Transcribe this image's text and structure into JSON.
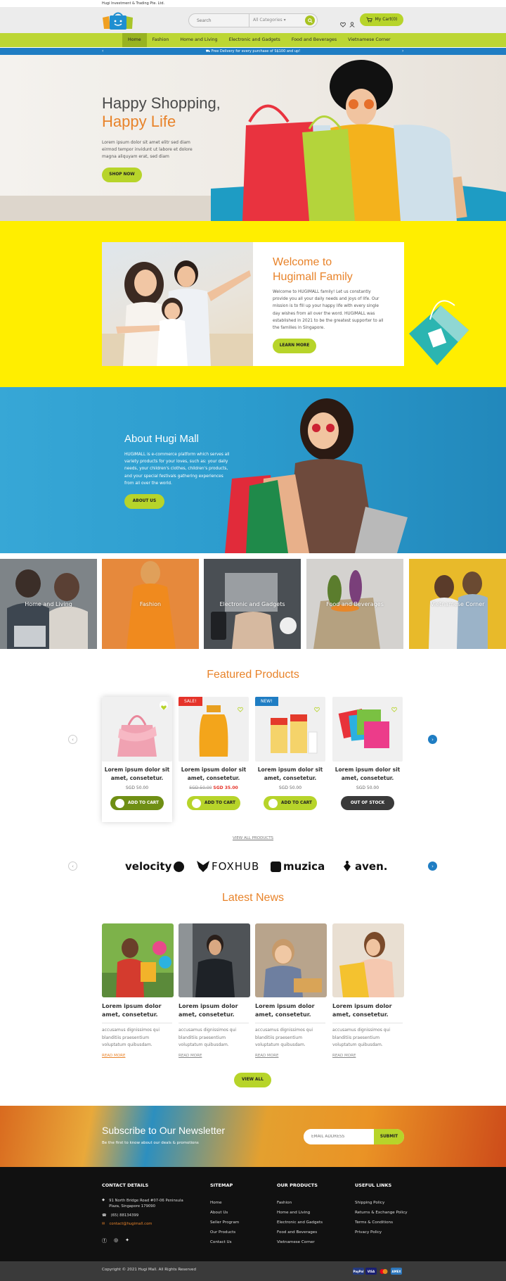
{
  "topbar": {
    "company": "Hugi Investment & Trading Pte. Ltd."
  },
  "header": {
    "search_placeholder": "Search",
    "category_select": "All Categories",
    "cart_label": "My Cart(0)"
  },
  "nav": {
    "items": [
      {
        "label": "Home"
      },
      {
        "label": "Fashion"
      },
      {
        "label": "Home and Living"
      },
      {
        "label": "Electronic and Gadgets"
      },
      {
        "label": "Food and Beverages"
      },
      {
        "label": "Vietnamese Corner"
      }
    ]
  },
  "promo": {
    "text": "Free Delivery for every purchase of S$100 and up!"
  },
  "hero": {
    "title1": "Happy Shopping,",
    "title2": "Happy Life",
    "text": "Lorem ipsum dolor sit amet elitr sed diam eirmod tempor invidunt ut labore et dolore magna aliquyam erat, sed diam",
    "button": "SHOP NOW"
  },
  "welcome": {
    "title": "Welcome to Hugimall Family",
    "text": "Welcome to HUGIMALL family! Let us constantly provide you all your daily needs and joys of life. Our mission is to fill up your happy life with every single day wishes from all over the word. HUGIMALL was established in 2021 to be the greatest supporter to all the families in Singapore.",
    "button": "LEARN MORE"
  },
  "about": {
    "title": "About Hugi Mall",
    "text": "HUGIMALL is e-commerce platform which serves all variety products for your loves, such as: your daily needs, your children's clothes, children's products, and your special festivals gathering experiences from all over the world.",
    "button": "ABOUT US"
  },
  "categories": [
    {
      "label": "Home and Living",
      "color": "#8a8f93"
    },
    {
      "label": "Fashion",
      "color": "#e68a3e"
    },
    {
      "label": "Electronic and Gadgets",
      "color": "#4b5054"
    },
    {
      "label": "Food and Beverages",
      "color": "#c9c3b8"
    },
    {
      "label": "Vietnamese Corner",
      "color": "#e8b82a"
    }
  ],
  "featured": {
    "title": "Featured Products",
    "products": [
      {
        "name": "Lorem ipsum dolor sit amet, consetetur.",
        "price": "SGD 50.00",
        "old_price": "",
        "button": "ADD TO CART",
        "badge": ""
      },
      {
        "name": "Lorem ipsum dolor sit amet, consetetur.",
        "price": "SGD 35.00",
        "old_price": "SGD 50.00",
        "button": "ADD TO CART",
        "badge": "SALE!"
      },
      {
        "name": "Lorem ipsum dolor sit amet, consetetur.",
        "price": "SGD 50.00",
        "old_price": "",
        "button": "ADD TO CART",
        "badge": "NEW!"
      },
      {
        "name": "Lorem ipsum dolor sit amet, consetetur.",
        "price": "SGD 50.00",
        "old_price": "",
        "button": "OUT OF STOCK",
        "badge": ""
      }
    ],
    "view_all": "VIEW ALL PRODUCTS"
  },
  "brands": [
    {
      "name": "velocity"
    },
    {
      "name": "FOXHUB"
    },
    {
      "name": "muzica"
    },
    {
      "name": "aven."
    }
  ],
  "news": {
    "title": "Latest News",
    "items": [
      {
        "title": "Lorem ipsum dolor amet, consetetur.",
        "text": "accusamus dignissimos qui blanditiis praesentium voluptatum quibusdam.",
        "more": "READ MORE"
      },
      {
        "title": "Lorem ipsum dolor amet, consetetur.",
        "text": "accusamus dignissimos qui blanditiis praesentium voluptatum quibusdam.",
        "more": "READ MORE"
      },
      {
        "title": "Lorem ipsum dolor amet, consetetur.",
        "text": "accusamus dignissimos qui blanditiis praesentium voluptatum quibusdam.",
        "more": "READ MORE"
      },
      {
        "title": "Lorem ipsum dolor amet, consetetur.",
        "text": "accusamus dignissimos qui blanditiis praesentium voluptatum quibusdam.",
        "more": "READ MORE"
      }
    ],
    "view_all": "VIEW ALL"
  },
  "newsletter": {
    "title": "Subscribe to Our Newsletter",
    "subtitle": "Be the first to know about our deals & promotions",
    "placeholder": "EMAIL ADDRESS",
    "button": "SUBMIT"
  },
  "footer": {
    "contact": {
      "title": "CONTACT DETAILS",
      "address": "91 North Bridge Road #07-06 Peninsula Plaza, Singapore 179090",
      "phone": "(65) 88134399",
      "email": "contact@hugimall.com"
    },
    "sitemap": {
      "title": "SITEMAP",
      "items": [
        "Home",
        "About Us",
        "Seller Program",
        "Our Products",
        "Contact Us"
      ]
    },
    "products": {
      "title": "OUR PRODUCTS",
      "items": [
        "Fashion",
        "Home and Living",
        "Electronic and Gadgets",
        "Food and Beverages",
        "Vietnamese Corner"
      ]
    },
    "links": {
      "title": "USEFUL LINKS",
      "items": [
        "Shipping Policy",
        "Returns & Exchange Policy",
        "Terms & Conditions",
        "Privacy Policy"
      ]
    },
    "copyright": "Copyright © 2021 Hugi Mall. All Rights Reserved",
    "payments": [
      "PayPal",
      "VISA",
      "MasterCard",
      "AMEX"
    ]
  },
  "colors": {
    "accent": "#b7d42a",
    "orange": "#e8832a",
    "blue": "#1f7dc3",
    "yellow": "#ffee00"
  }
}
